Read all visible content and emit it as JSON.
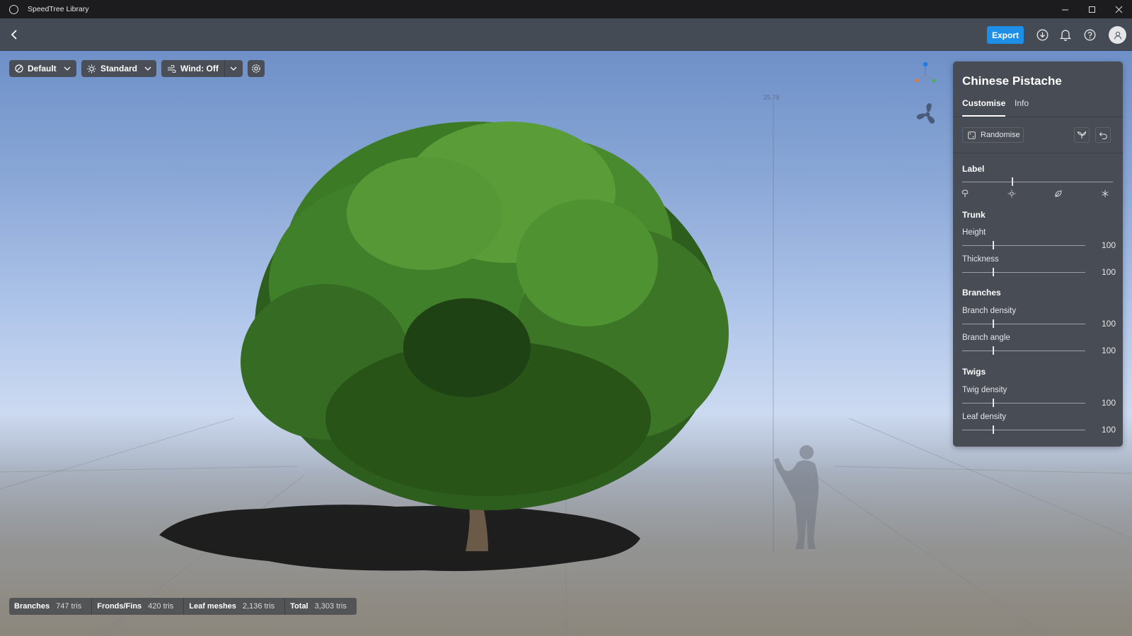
{
  "window": {
    "title": "SpeedTree Library"
  },
  "header": {
    "export_label": "Export"
  },
  "viewport": {
    "shading_label": "Default",
    "lighting_label": "Standard",
    "wind_label": "Wind: Off",
    "measure_label": "25.79"
  },
  "stats": [
    {
      "key": "Branches",
      "value": "747 tris"
    },
    {
      "key": "Fronds/Fins",
      "value": "420 tris"
    },
    {
      "key": "Leaf meshes",
      "value": "2,136 tris"
    },
    {
      "key": "Total",
      "value": "3,303 tris"
    }
  ],
  "panel": {
    "title": "Chinese Pistache",
    "tabs": [
      "Customise",
      "Info"
    ],
    "randomise_label": "Randomise",
    "label_heading": "Label",
    "label_season_level": 0.33,
    "sections": [
      {
        "heading": "Trunk",
        "fields": [
          {
            "label": "Height",
            "value": "100"
          },
          {
            "label": "Thickness",
            "value": "100"
          }
        ]
      },
      {
        "heading": "Branches",
        "fields": [
          {
            "label": "Branch density",
            "value": "100"
          },
          {
            "label": "Branch angle",
            "value": "100"
          }
        ]
      },
      {
        "heading": "Twigs",
        "fields": [
          {
            "label": "Twig density",
            "value": "100"
          },
          {
            "label": "Leaf density",
            "value": "100"
          }
        ]
      }
    ]
  },
  "colors": {
    "accent": "#1d8fe8",
    "panel": "#474c55",
    "header": "#454b54"
  }
}
